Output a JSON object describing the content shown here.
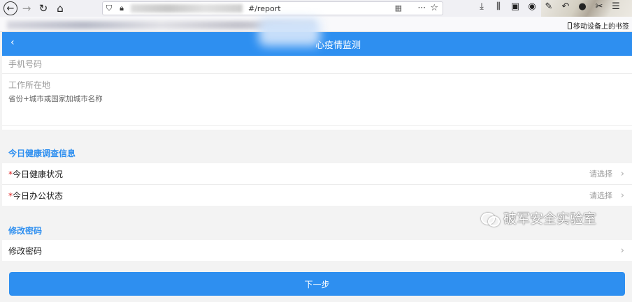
{
  "browser": {
    "url_suffix": "#/report",
    "bookmark_device": "移动设备上的书签"
  },
  "header": {
    "title": "心疫情监测"
  },
  "form": {
    "phone_label": "手机号码",
    "work_location_label": "工作所在地",
    "work_location_hint": "省份+城市或国家加城市名称",
    "health_section_title": "今日健康调查信息",
    "health_status_label": "今日健康状况",
    "office_status_label": "今日办公状态",
    "select_placeholder": "请选择",
    "required_mark": "*",
    "password_section_title": "修改密码",
    "password_row_label": "修改密码",
    "next_button": "下一步"
  },
  "watermark": {
    "text": "破军安全实验室"
  },
  "colors": {
    "accent": "#2e8ff0",
    "required": "#e02020"
  }
}
